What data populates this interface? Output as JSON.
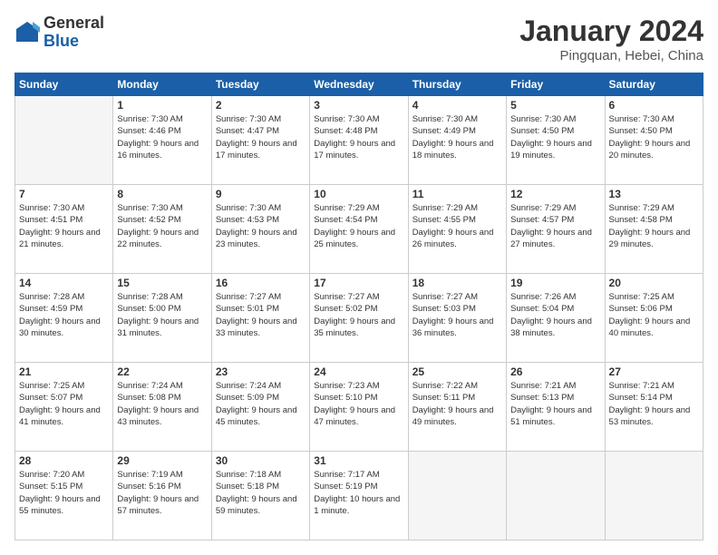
{
  "logo": {
    "general": "General",
    "blue": "Blue"
  },
  "header": {
    "title": "January 2024",
    "subtitle": "Pingquan, Hebei, China"
  },
  "weekdays": [
    "Sunday",
    "Monday",
    "Tuesday",
    "Wednesday",
    "Thursday",
    "Friday",
    "Saturday"
  ],
  "weeks": [
    [
      {
        "day": "",
        "empty": true
      },
      {
        "day": "1",
        "sunrise": "Sunrise: 7:30 AM",
        "sunset": "Sunset: 4:46 PM",
        "daylight": "Daylight: 9 hours and 16 minutes."
      },
      {
        "day": "2",
        "sunrise": "Sunrise: 7:30 AM",
        "sunset": "Sunset: 4:47 PM",
        "daylight": "Daylight: 9 hours and 17 minutes."
      },
      {
        "day": "3",
        "sunrise": "Sunrise: 7:30 AM",
        "sunset": "Sunset: 4:48 PM",
        "daylight": "Daylight: 9 hours and 17 minutes."
      },
      {
        "day": "4",
        "sunrise": "Sunrise: 7:30 AM",
        "sunset": "Sunset: 4:49 PM",
        "daylight": "Daylight: 9 hours and 18 minutes."
      },
      {
        "day": "5",
        "sunrise": "Sunrise: 7:30 AM",
        "sunset": "Sunset: 4:50 PM",
        "daylight": "Daylight: 9 hours and 19 minutes."
      },
      {
        "day": "6",
        "sunrise": "Sunrise: 7:30 AM",
        "sunset": "Sunset: 4:50 PM",
        "daylight": "Daylight: 9 hours and 20 minutes."
      }
    ],
    [
      {
        "day": "7",
        "sunrise": "Sunrise: 7:30 AM",
        "sunset": "Sunset: 4:51 PM",
        "daylight": "Daylight: 9 hours and 21 minutes."
      },
      {
        "day": "8",
        "sunrise": "Sunrise: 7:30 AM",
        "sunset": "Sunset: 4:52 PM",
        "daylight": "Daylight: 9 hours and 22 minutes."
      },
      {
        "day": "9",
        "sunrise": "Sunrise: 7:30 AM",
        "sunset": "Sunset: 4:53 PM",
        "daylight": "Daylight: 9 hours and 23 minutes."
      },
      {
        "day": "10",
        "sunrise": "Sunrise: 7:29 AM",
        "sunset": "Sunset: 4:54 PM",
        "daylight": "Daylight: 9 hours and 25 minutes."
      },
      {
        "day": "11",
        "sunrise": "Sunrise: 7:29 AM",
        "sunset": "Sunset: 4:55 PM",
        "daylight": "Daylight: 9 hours and 26 minutes."
      },
      {
        "day": "12",
        "sunrise": "Sunrise: 7:29 AM",
        "sunset": "Sunset: 4:57 PM",
        "daylight": "Daylight: 9 hours and 27 minutes."
      },
      {
        "day": "13",
        "sunrise": "Sunrise: 7:29 AM",
        "sunset": "Sunset: 4:58 PM",
        "daylight": "Daylight: 9 hours and 29 minutes."
      }
    ],
    [
      {
        "day": "14",
        "sunrise": "Sunrise: 7:28 AM",
        "sunset": "Sunset: 4:59 PM",
        "daylight": "Daylight: 9 hours and 30 minutes."
      },
      {
        "day": "15",
        "sunrise": "Sunrise: 7:28 AM",
        "sunset": "Sunset: 5:00 PM",
        "daylight": "Daylight: 9 hours and 31 minutes."
      },
      {
        "day": "16",
        "sunrise": "Sunrise: 7:27 AM",
        "sunset": "Sunset: 5:01 PM",
        "daylight": "Daylight: 9 hours and 33 minutes."
      },
      {
        "day": "17",
        "sunrise": "Sunrise: 7:27 AM",
        "sunset": "Sunset: 5:02 PM",
        "daylight": "Daylight: 9 hours and 35 minutes."
      },
      {
        "day": "18",
        "sunrise": "Sunrise: 7:27 AM",
        "sunset": "Sunset: 5:03 PM",
        "daylight": "Daylight: 9 hours and 36 minutes."
      },
      {
        "day": "19",
        "sunrise": "Sunrise: 7:26 AM",
        "sunset": "Sunset: 5:04 PM",
        "daylight": "Daylight: 9 hours and 38 minutes."
      },
      {
        "day": "20",
        "sunrise": "Sunrise: 7:25 AM",
        "sunset": "Sunset: 5:06 PM",
        "daylight": "Daylight: 9 hours and 40 minutes."
      }
    ],
    [
      {
        "day": "21",
        "sunrise": "Sunrise: 7:25 AM",
        "sunset": "Sunset: 5:07 PM",
        "daylight": "Daylight: 9 hours and 41 minutes."
      },
      {
        "day": "22",
        "sunrise": "Sunrise: 7:24 AM",
        "sunset": "Sunset: 5:08 PM",
        "daylight": "Daylight: 9 hours and 43 minutes."
      },
      {
        "day": "23",
        "sunrise": "Sunrise: 7:24 AM",
        "sunset": "Sunset: 5:09 PM",
        "daylight": "Daylight: 9 hours and 45 minutes."
      },
      {
        "day": "24",
        "sunrise": "Sunrise: 7:23 AM",
        "sunset": "Sunset: 5:10 PM",
        "daylight": "Daylight: 9 hours and 47 minutes."
      },
      {
        "day": "25",
        "sunrise": "Sunrise: 7:22 AM",
        "sunset": "Sunset: 5:11 PM",
        "daylight": "Daylight: 9 hours and 49 minutes."
      },
      {
        "day": "26",
        "sunrise": "Sunrise: 7:21 AM",
        "sunset": "Sunset: 5:13 PM",
        "daylight": "Daylight: 9 hours and 51 minutes."
      },
      {
        "day": "27",
        "sunrise": "Sunrise: 7:21 AM",
        "sunset": "Sunset: 5:14 PM",
        "daylight": "Daylight: 9 hours and 53 minutes."
      }
    ],
    [
      {
        "day": "28",
        "sunrise": "Sunrise: 7:20 AM",
        "sunset": "Sunset: 5:15 PM",
        "daylight": "Daylight: 9 hours and 55 minutes."
      },
      {
        "day": "29",
        "sunrise": "Sunrise: 7:19 AM",
        "sunset": "Sunset: 5:16 PM",
        "daylight": "Daylight: 9 hours and 57 minutes."
      },
      {
        "day": "30",
        "sunrise": "Sunrise: 7:18 AM",
        "sunset": "Sunset: 5:18 PM",
        "daylight": "Daylight: 9 hours and 59 minutes."
      },
      {
        "day": "31",
        "sunrise": "Sunrise: 7:17 AM",
        "sunset": "Sunset: 5:19 PM",
        "daylight": "Daylight: 10 hours and 1 minute."
      },
      {
        "day": "",
        "empty": true
      },
      {
        "day": "",
        "empty": true
      },
      {
        "day": "",
        "empty": true
      }
    ]
  ]
}
